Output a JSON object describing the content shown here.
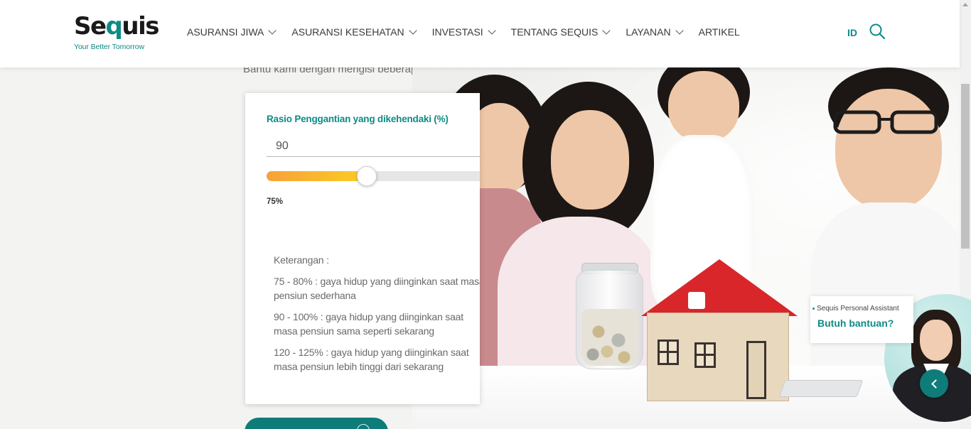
{
  "brand": {
    "logo_text_a": "Se",
    "logo_text_q": "q",
    "logo_text_b": "uis",
    "tagline": "Your Better Tomorrow",
    "accent_color": "#0e8b86"
  },
  "nav": {
    "items": [
      {
        "label": "ASURANSI JIWA",
        "has_dropdown": true
      },
      {
        "label": "ASURANSI KESEHATAN",
        "has_dropdown": true
      },
      {
        "label": "INVESTASI",
        "has_dropdown": true
      },
      {
        "label": "TENTANG SEQUIS",
        "has_dropdown": true
      },
      {
        "label": "LAYANAN",
        "has_dropdown": true
      },
      {
        "label": "ARTIKEL",
        "has_dropdown": false
      }
    ],
    "language": "ID",
    "search_icon": "search-icon"
  },
  "page": {
    "subtitle": "Bantu kami dengan mengisi beberapa dat"
  },
  "calculator": {
    "field_label": "Rasio Penggantian yang dikehendaki (%)",
    "field_value": "90",
    "slider_label": "75%",
    "slider_fraction": 0.44,
    "notes_title": "Keterangan :",
    "notes": [
      "75 - 80% : gaya hidup yang diinginkan saat masa pensiun sederhana",
      "90 - 100% : gaya hidup yang diinginkan saat masa pensiun sama seperti sekarang",
      "120 - 125% : gaya hidup yang diinginkan saat masa pensiun lebih tinggi dari sekarang"
    ]
  },
  "assistant": {
    "name": "Sequis Personal Assistant",
    "prompt": "Butuh bantuan?"
  }
}
